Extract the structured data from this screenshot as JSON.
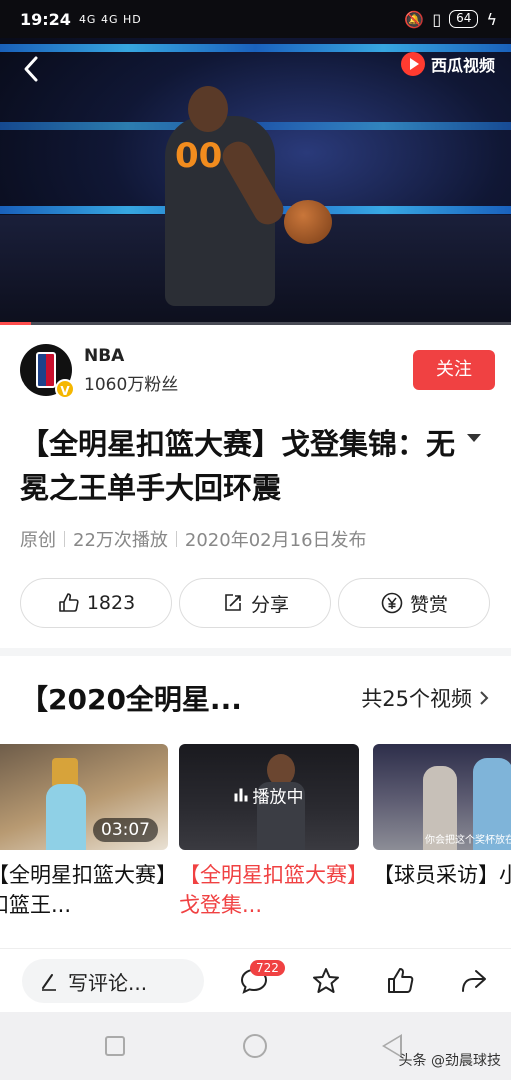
{
  "status_bar": {
    "time": "19:24",
    "signal": "4G 4G HD",
    "battery": "64"
  },
  "video": {
    "brand": "西瓜视频",
    "jersey_number": "00",
    "progress_fraction": 0.06
  },
  "author": {
    "name": "NBA",
    "fans": "1060万粉丝",
    "verified_badge": "V",
    "follow_label": "关注"
  },
  "title": "【全明星扣篮大赛】戈登集锦：无冕之王单手大回环震",
  "meta": {
    "type": "原创",
    "plays": "22万次播放",
    "date": "2020年02月16日发布"
  },
  "actions": {
    "like_count": "1823",
    "share_label": "分享",
    "reward_label": "赞赏"
  },
  "collection": {
    "title": "【2020全明星...",
    "count": "共25个视频"
  },
  "thumbs": [
    {
      "caption": "【全明星扣篮大赛】扣篮王...",
      "duration": "03:07"
    },
    {
      "caption": "【全明星扣篮大赛】戈登集...",
      "status": "播放中"
    },
    {
      "caption": "【球员采访】小琼斯谈夺扣",
      "overlay": "你会把这个奖杯放在哪"
    }
  ],
  "comment_bar": {
    "placeholder": "写评论...",
    "comment_count": "722"
  },
  "watermark": "头条 @劲晨球技",
  "colors": {
    "accent": "#f04142",
    "meta_text": "#888888"
  }
}
